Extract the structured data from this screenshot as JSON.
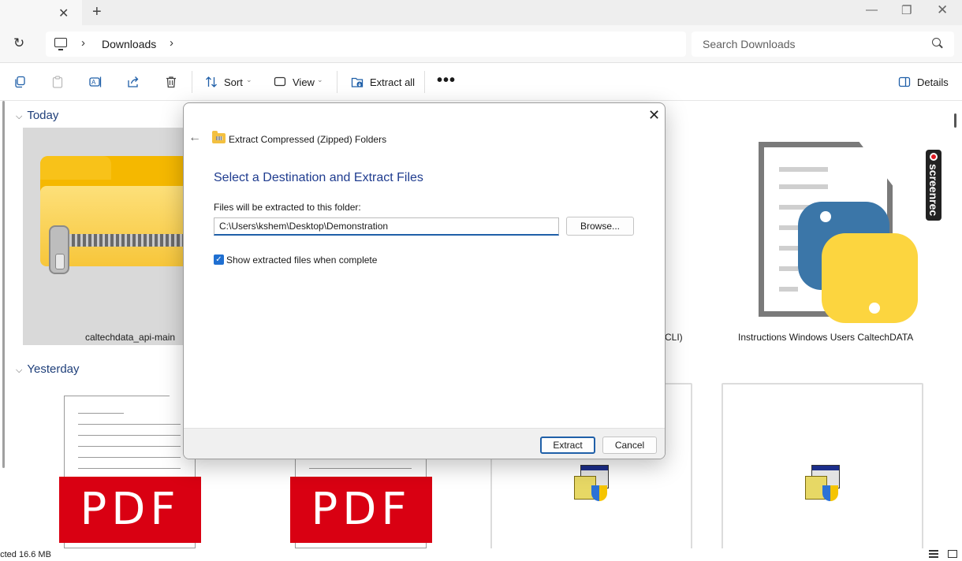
{
  "address": {
    "breadcrumb": "Downloads",
    "search_placeholder": "Search Downloads"
  },
  "toolbar": {
    "sort_label": "Sort",
    "view_label": "View",
    "extract_all_label": "Extract all",
    "more_label": "•••",
    "details_label": "Details"
  },
  "sections": {
    "today": "Today",
    "yesterday": "Yesterday"
  },
  "files": {
    "zip_name": "caltechdata_api-main",
    "partial_name": "CLI)",
    "python_doc_name": "Instructions Windows Users CaltechDATA",
    "pdf_badge": "PDF"
  },
  "overlay": {
    "screenrec_label": "screenrec"
  },
  "status": {
    "text": "ected  16.6 MB"
  },
  "dialog": {
    "window_title": "Extract Compressed (Zipped) Folders",
    "heading": "Select a Destination and Extract Files",
    "folder_label": "Files will be extracted to this folder:",
    "path_value": "C:\\Users\\kshem\\Desktop\\Demonstration",
    "browse_label": "Browse...",
    "show_files_label": "Show extracted files when complete",
    "show_files_checked": true,
    "extract_label": "Extract",
    "cancel_label": "Cancel"
  },
  "colors": {
    "accent": "#1f5fa8",
    "heading_blue": "#1f3c8f",
    "pdf_red": "#d90012",
    "zip_yellow": "#f5b800"
  },
  "icons": [
    "close-icon",
    "new-tab-icon",
    "minimize-icon",
    "maximize-icon",
    "window-close-icon",
    "refresh-icon",
    "this-pc-icon",
    "chevron-right-icon",
    "search-icon",
    "copy-icon",
    "paste-icon",
    "rename-icon",
    "share-icon",
    "delete-icon",
    "sort-icon",
    "view-icon",
    "extract-icon",
    "more-icon",
    "details-icon",
    "back-arrow-icon",
    "zip-folder-icon",
    "check-icon"
  ]
}
